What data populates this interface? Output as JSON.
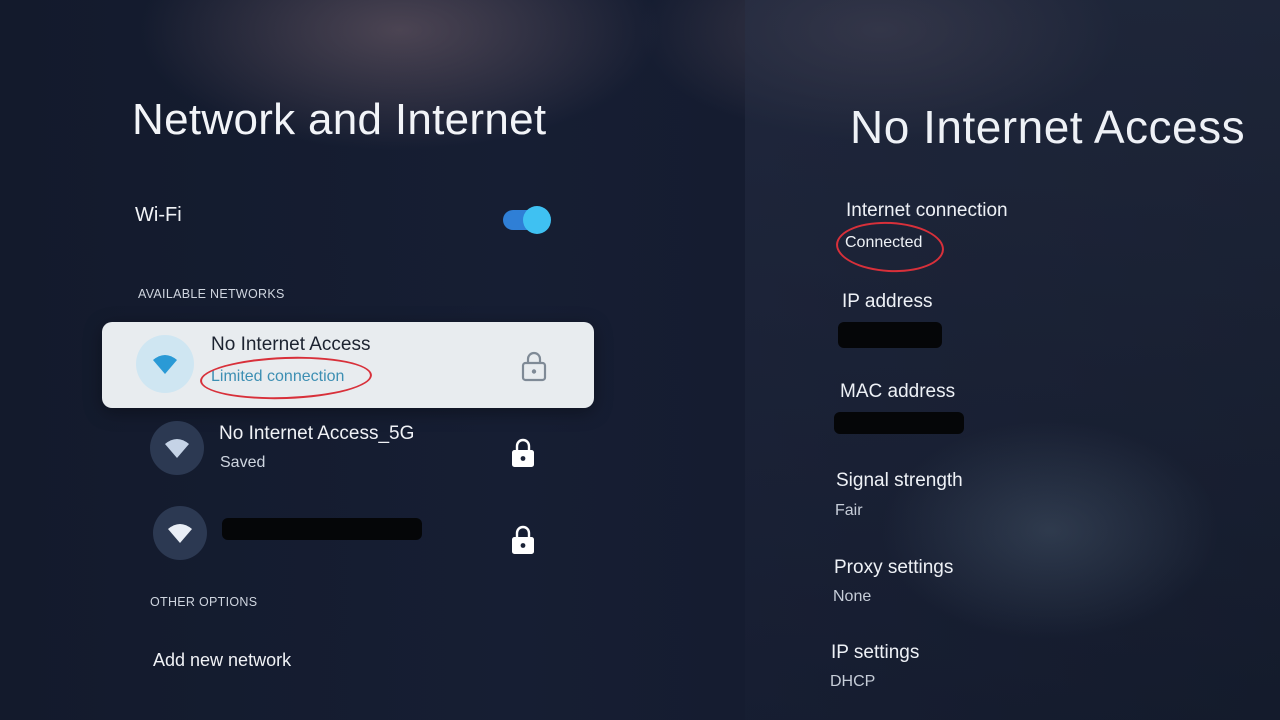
{
  "left_panel": {
    "title": "Network and Internet",
    "wifi": {
      "label": "Wi-Fi",
      "enabled": true
    },
    "available_networks_header": "AVAILABLE NETWORKS",
    "networks": [
      {
        "name": "No Internet Access",
        "status": "Limited connection",
        "selected": true,
        "locked": true,
        "status_circled": true
      },
      {
        "name": "No Internet Access_5G",
        "status": "Saved",
        "selected": false,
        "locked": true
      },
      {
        "name": "",
        "status": "",
        "selected": false,
        "locked": true,
        "name_redacted": true
      }
    ],
    "other_options_header": "OTHER OPTIONS",
    "add_network_label": "Add new network"
  },
  "right_panel": {
    "title": "No Internet Access",
    "details": [
      {
        "label": "Internet connection",
        "value": "Connected",
        "value_circled": true
      },
      {
        "label": "IP address",
        "value": "",
        "redacted": true
      },
      {
        "label": "MAC address",
        "value": "",
        "redacted": true
      },
      {
        "label": "Signal strength",
        "value": "Fair"
      },
      {
        "label": "Proxy settings",
        "value": "None"
      },
      {
        "label": "IP settings",
        "value": "DHCP"
      }
    ]
  },
  "colors": {
    "toggle_track": "#2f7fd6",
    "toggle_knob": "#3fc1f2",
    "annotation_red": "#d8303a",
    "selected_card": "#e8ecef",
    "limited_text": "#3d8fb3"
  },
  "icons": {
    "network": "wifi-icon",
    "lock": "lock-icon"
  }
}
